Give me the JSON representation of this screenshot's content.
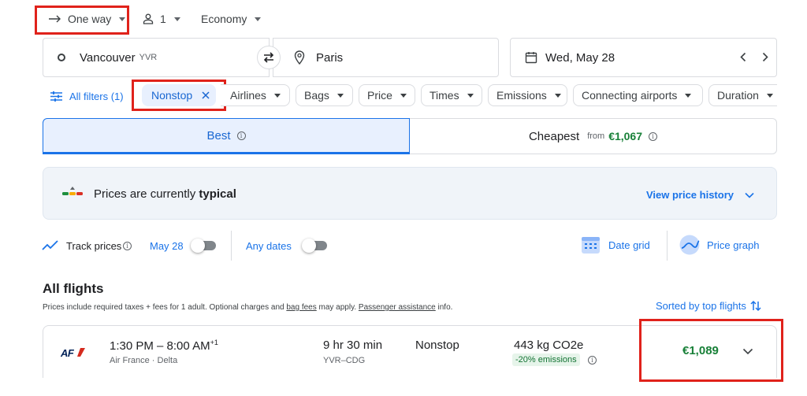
{
  "trip": {
    "type_label": "One way",
    "passengers": "1",
    "cabin": "Economy"
  },
  "search": {
    "origin": "Vancouver",
    "origin_code": "YVR",
    "destination": "Paris",
    "date": "Wed, May 28"
  },
  "filters": {
    "all_filters": "All filters (1)",
    "active_chip": "Nonstop",
    "chips": [
      "Airlines",
      "Bags",
      "Price",
      "Times",
      "Emissions",
      "Connecting airports",
      "Duration"
    ]
  },
  "tabs": {
    "best": "Best",
    "cheapest": "Cheapest",
    "cheapest_from": "from",
    "cheapest_price": "€1,067"
  },
  "price_insight": {
    "text_prefix": "Prices are currently ",
    "text_emphasis": "typical",
    "history_link": "View price history"
  },
  "tracking": {
    "track_label": "Track prices",
    "date_label": "May 28",
    "any_dates": "Any dates",
    "date_grid": "Date grid",
    "price_graph": "Price graph"
  },
  "results": {
    "heading": "All flights",
    "note_prefix": "Prices include required taxes + fees for 1 adult. Optional charges and ",
    "note_link1": "bag fees",
    "note_middle": " may apply. ",
    "note_link2": "Passenger assistance",
    "note_suffix": " info.",
    "sort_label": "Sorted by top flights"
  },
  "flight": {
    "airline_logo": "AF",
    "time_range": "1:30 PM – 8:00 AM",
    "day_offset": "+1",
    "carriers": "Air France · Delta",
    "duration": "9 hr 30 min",
    "route": "YVR–CDG",
    "stops": "Nonstop",
    "emissions": "443 kg CO2e",
    "emissions_badge": "-20% emissions",
    "price": "€1,089"
  },
  "colors": {
    "accent": "#1a73e8",
    "price_green": "#188038",
    "highlight_red": "#e0221b",
    "selected_tab_bg": "#e8f0fe"
  }
}
